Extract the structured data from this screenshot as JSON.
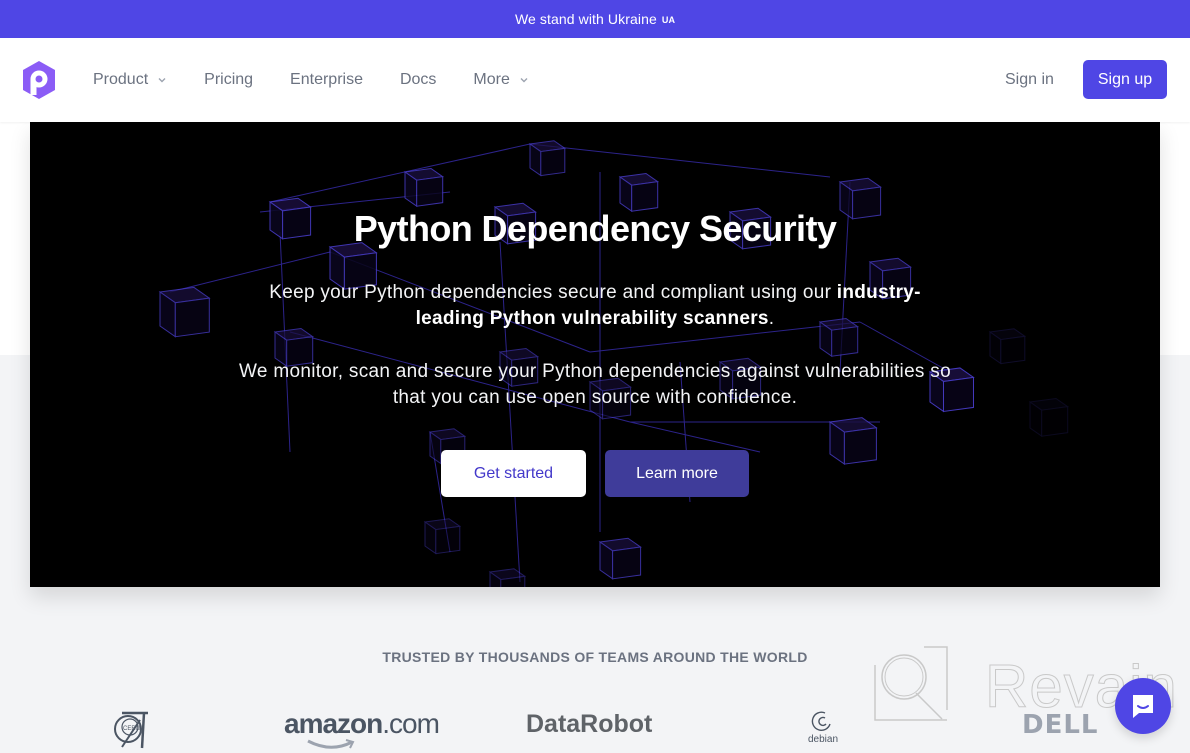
{
  "banner": {
    "text": "We stand with Ukraine",
    "flag": "UA"
  },
  "nav": {
    "logo_icon": "pyup-hexagon-logo",
    "items": [
      {
        "label": "Product",
        "has_dropdown": true
      },
      {
        "label": "Pricing",
        "has_dropdown": false
      },
      {
        "label": "Enterprise",
        "has_dropdown": false
      },
      {
        "label": "Docs",
        "has_dropdown": false
      },
      {
        "label": "More",
        "has_dropdown": true
      }
    ],
    "signin_label": "Sign in",
    "signup_label": "Sign up"
  },
  "hero": {
    "title": "Python Dependency Security",
    "paragraph1_plain": "Keep your Python dependencies secure and compliant using our ",
    "paragraph1_bold": "industry-leading Python vulnerability scanners",
    "paragraph1_end": ".",
    "paragraph2": "We monitor, scan and secure your Python dependencies against vulnerabilities so that you can use open source with confidence.",
    "primary_button": "Get started",
    "secondary_button": "Learn more"
  },
  "trusted": {
    "heading": "TRUSTED BY THOUSANDS OF TEAMS AROUND THE WORLD",
    "logos": [
      {
        "name": "CERN",
        "text": "CERN"
      },
      {
        "name": "Amazon",
        "text_main": "amazon",
        "text_suffix": ".com"
      },
      {
        "name": "DataRobot",
        "text": "DataRobot"
      },
      {
        "name": "Debian",
        "text": "debian"
      },
      {
        "name": "Dell",
        "text": "DELL"
      }
    ]
  },
  "watermark": {
    "text": "Revain"
  },
  "chat_widget": {
    "icon": "chat-bubble-icon"
  },
  "colors": {
    "brand": "#4f46e5",
    "secondary_button": "#3f3c9a",
    "logo_purple": "#8b5cf6",
    "hero_bg": "#000000",
    "cube_stroke": "#3b2fb8"
  }
}
